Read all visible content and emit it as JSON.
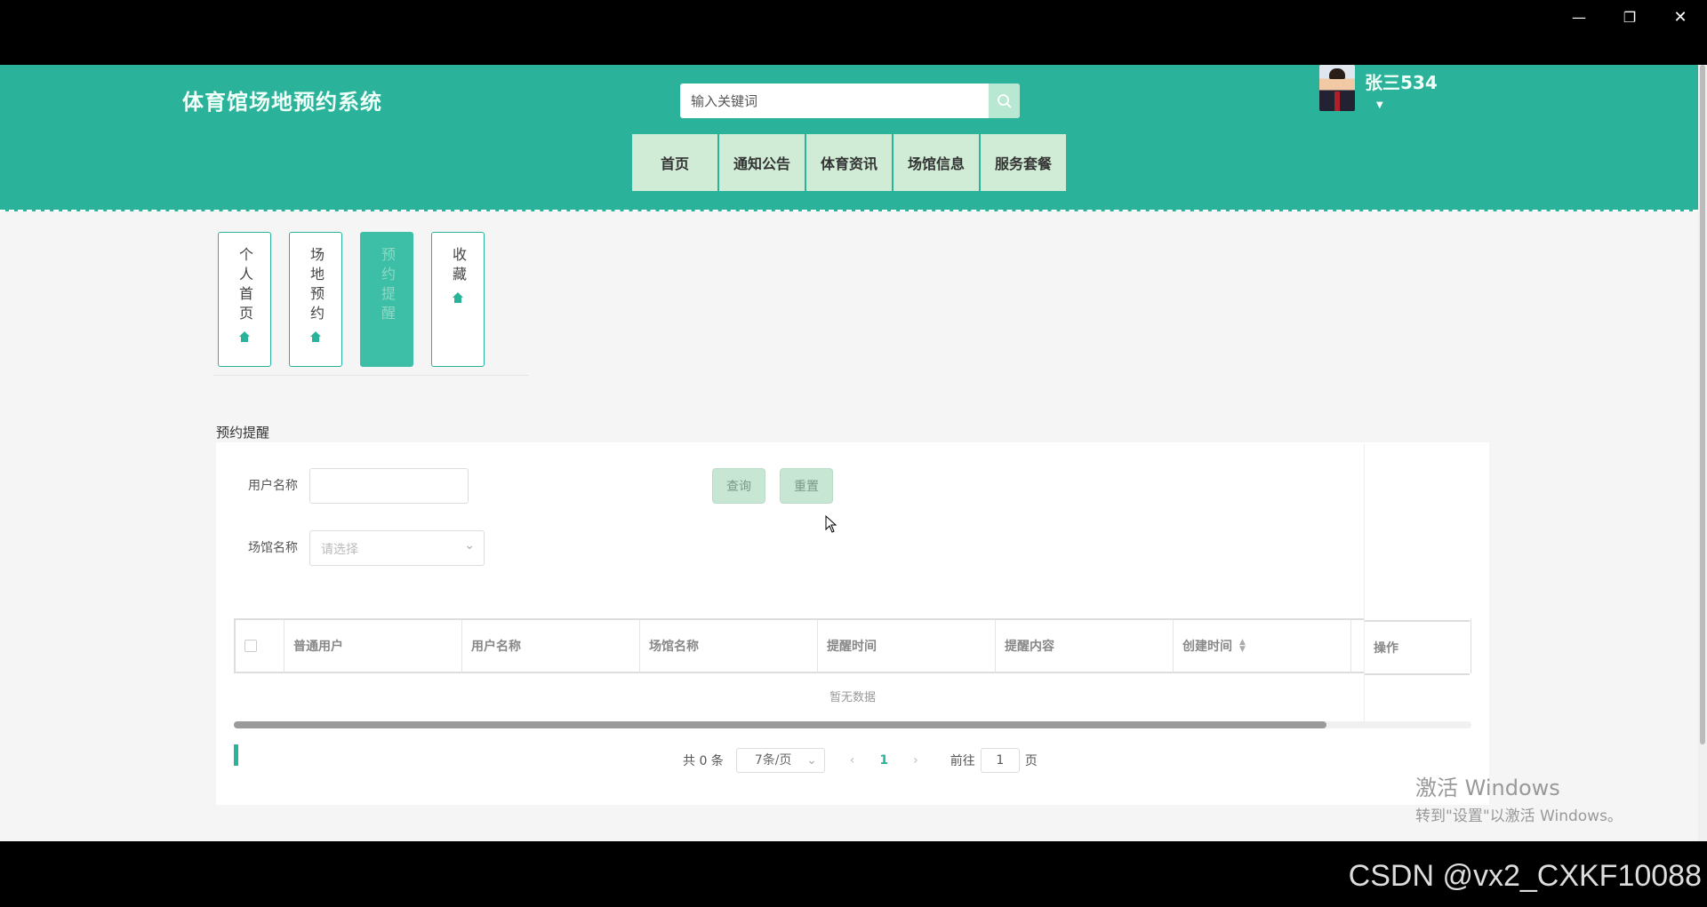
{
  "window": {
    "minimize": "—",
    "restore": "❐",
    "close": "✕"
  },
  "header": {
    "site_title": "体育馆场地预约系统",
    "search_placeholder": "输入关键词",
    "username": "张三534",
    "nav": [
      "首页",
      "通知公告",
      "体育资讯",
      "场馆信息",
      "服务套餐"
    ]
  },
  "tabs": [
    {
      "label": "个人首页",
      "active": false
    },
    {
      "label": "场地预约",
      "active": false
    },
    {
      "label": "预约提醒",
      "active": true
    },
    {
      "label": "收藏",
      "active": false
    }
  ],
  "section_title": "预约提醒",
  "filters": {
    "username_label": "用户名称",
    "venue_label": "场馆名称",
    "venue_placeholder": "请选择",
    "query_button": "查询",
    "reset_button": "重置"
  },
  "table": {
    "columns": [
      "普通用户",
      "用户名称",
      "场馆名称",
      "提醒时间",
      "提醒内容",
      "创建时间",
      "操作"
    ],
    "empty_text": "暂无数据"
  },
  "pagination": {
    "total": "共 0 条",
    "page_size": "7条/页",
    "current_page": "1",
    "goto_label": "前往",
    "goto_value": "1",
    "page_unit": "页"
  },
  "watermark": {
    "activate_line1": "激活 Windows",
    "activate_line2": "转到\"设置\"以激活 Windows。",
    "csdn": "CSDN @vx2_CXKF10088"
  },
  "colors": {
    "primary": "#2ab39a",
    "nav_bg": "#d1ecd6",
    "button_bg": "#c7e6d3"
  }
}
